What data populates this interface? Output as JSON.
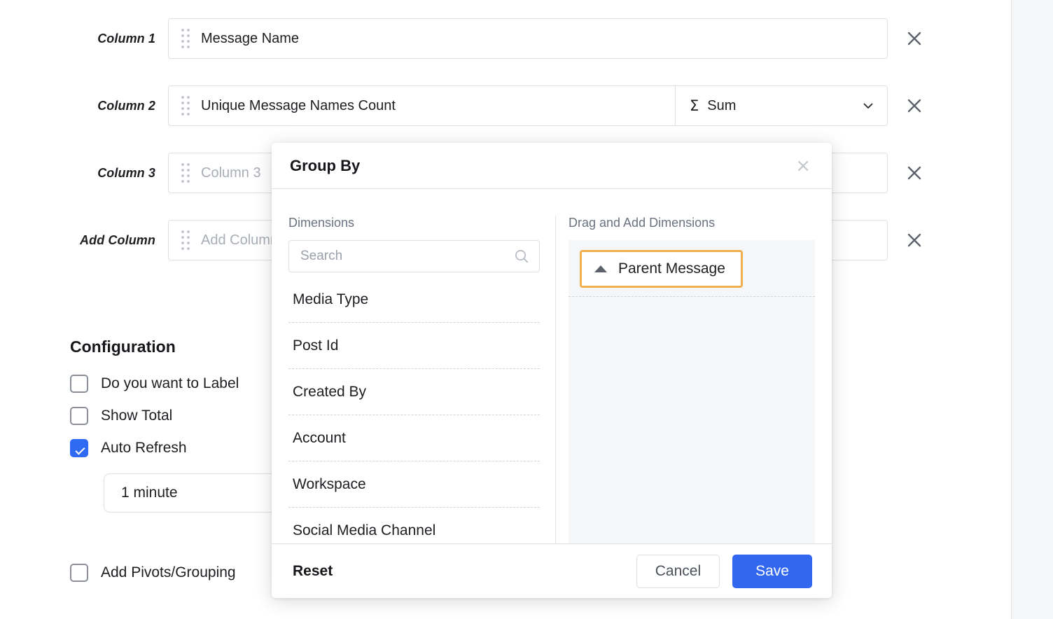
{
  "theme": {
    "accent_blue": "#3268f0",
    "highlight_orange": "#efb04e",
    "text_dark": "#1c1e21",
    "text_muted": "#6b7280",
    "border_gray": "#dcdfe4",
    "panel_gray": "#f5f6f8"
  },
  "columns": [
    {
      "label": "Column 1",
      "value": "Message Name",
      "is_placeholder": false,
      "has_aggregate": false,
      "aggregate": null,
      "aggregate_icon": null,
      "remove_icon": "close-icon"
    },
    {
      "label": "Column 2",
      "value": "Unique Message Names Count",
      "is_placeholder": false,
      "has_aggregate": true,
      "aggregate": "Sum",
      "aggregate_icon": "sigma-icon",
      "remove_icon": "close-icon"
    },
    {
      "label": "Column 3",
      "value": "Column 3",
      "is_placeholder": true,
      "has_aggregate": false,
      "aggregate": null,
      "aggregate_icon": null,
      "remove_icon": "close-icon"
    },
    {
      "label": "Add Column",
      "value": "Add Column",
      "is_placeholder": true,
      "has_aggregate": false,
      "aggregate": null,
      "aggregate_icon": null,
      "remove_icon": "close-icon"
    }
  ],
  "configuration": {
    "title": "Configuration",
    "options": [
      {
        "label": "Do you want to Label",
        "checked": false
      },
      {
        "label": "Show Total",
        "checked": false
      },
      {
        "label": "Auto Refresh",
        "checked": true
      }
    ],
    "refresh_interval": "1 minute",
    "pivot_option": {
      "label": "Add Pivots/Grouping",
      "checked": false
    }
  },
  "modal": {
    "title": "Group By",
    "close_icon": "close-icon",
    "left_pane": {
      "caption": "Dimensions",
      "search": {
        "placeholder": "Search",
        "value": "",
        "icon": "search-icon"
      },
      "items": [
        "Media Type",
        "Post Id",
        "Created By",
        "Account",
        "Workspace",
        "Social Media Channel"
      ]
    },
    "right_pane": {
      "caption": "Drag and Add Dimensions",
      "chips": [
        {
          "label": "Parent Message",
          "sort": "ascending",
          "sort_icon": "caret-up-icon",
          "highlighted": true
        }
      ]
    },
    "footer": {
      "reset_label": "Reset",
      "cancel_label": "Cancel",
      "save_label": "Save"
    }
  }
}
